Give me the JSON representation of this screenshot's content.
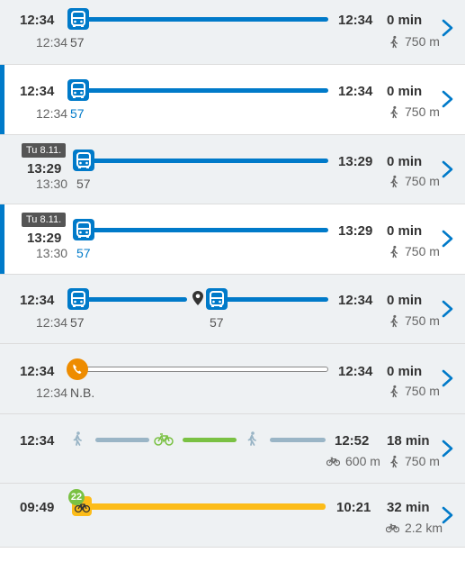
{
  "colors": {
    "bus": "#007ac9",
    "bike": "#7ac143",
    "walk": "#9ab5c6",
    "citybike": "#fcbc19",
    "call": "#ee8c00",
    "text": "#333333",
    "sub": "#666666"
  },
  "itineraries": [
    {
      "dep": "12:34",
      "dep_sub": "12:34",
      "route": "57",
      "arr": "12:34",
      "duration": "0 min",
      "walk": "750 m"
    },
    {
      "dep": "12:34",
      "dep_sub": "12:34",
      "route": "57",
      "arr": "12:34",
      "duration": "0 min",
      "walk": "750 m"
    },
    {
      "date_badge": "Tu 8.11.",
      "dep": "13:29",
      "dep_sub": "13:30",
      "route": "57",
      "arr": "13:29",
      "duration": "0 min",
      "walk": "750 m"
    },
    {
      "date_badge": "Tu 8.11.",
      "dep": "13:29",
      "dep_sub": "13:30",
      "route": "57",
      "arr": "13:29",
      "duration": "0 min",
      "walk": "750 m"
    },
    {
      "dep": "12:34",
      "dep_sub": "12:34",
      "route": "57",
      "route2": "57",
      "arr": "12:34",
      "duration": "0 min",
      "walk": "750 m"
    },
    {
      "dep": "12:34",
      "dep_sub": "12:34",
      "route": "N.B.",
      "arr": "12:34",
      "duration": "0 min",
      "walk": "750 m"
    },
    {
      "dep": "12:34",
      "arr": "12:52",
      "duration": "18 min",
      "bike": "600 m",
      "walk": "750 m"
    },
    {
      "dep": "09:49",
      "arr": "10:21",
      "duration": "32 min",
      "bike": "2.2 km",
      "station_badge": "22"
    }
  ]
}
